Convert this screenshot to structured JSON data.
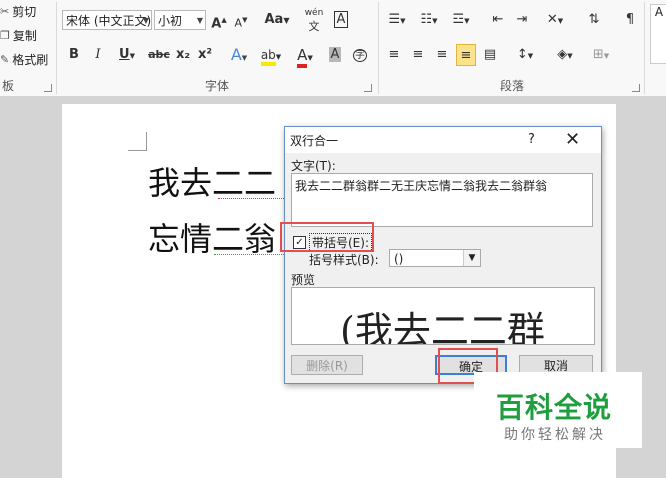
{
  "clipboard": {
    "cut": "剪切",
    "copy": "复制",
    "painter": "格式刷",
    "group": "板"
  },
  "font": {
    "name": "宋体 (中文正文)",
    "size": "小初",
    "group": "字体",
    "aa": "Aa",
    "wen": "wén",
    "wen_char": "文",
    "a_box": "A",
    "grow": "A",
    "shrink": "A",
    "bold": "B",
    "italic": "I",
    "underline": "U",
    "strike": "abc",
    "sub": "x₂",
    "sup": "x²",
    "effects": "A",
    "highlight": "ab",
    "color": "A",
    "shade": "A",
    "enclosed": "字"
  },
  "paragraph": {
    "group": "段落"
  },
  "styles": {
    "preview": "A"
  },
  "document": {
    "line1": "我去二二",
    "line2": "忘情二翁"
  },
  "dialog": {
    "title": "双行合一",
    "help": "?",
    "close": "✕",
    "text_label": "文字(T):",
    "text_value": "我去二二群翁群二无王庆忘情二翁我去二翁群翁",
    "bracket_label": "带括号(E):",
    "check_mark": "✓",
    "bracket_style_label": "括号样式(B):",
    "bracket_style_value": "()",
    "preview_label": "预览",
    "preview_text": "(我去二二群",
    "delete": "删除(R)",
    "ok": "确定",
    "cancel": "取消"
  },
  "watermark": {
    "line1": "百科全说",
    "line2": "助你轻松解决"
  },
  "colors": {
    "accent": "#3c7fd6",
    "highlight_red": "#e05050",
    "brand_green": "#1e9e3f"
  }
}
